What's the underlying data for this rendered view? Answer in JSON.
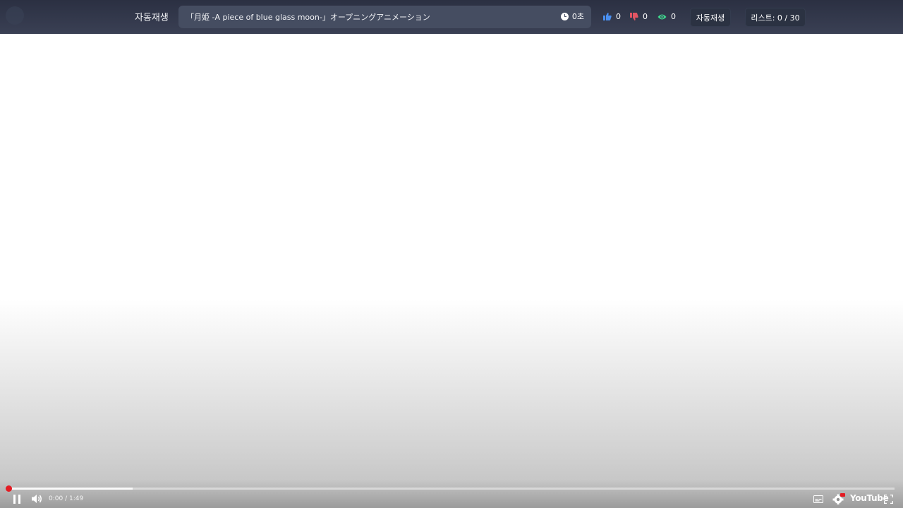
{
  "header": {
    "autoplay_title": "자동재생",
    "video_title": "「月姫 -A piece of blue glass moon-」オープニングアニメーション",
    "timer": "0초",
    "likes": "0",
    "dislikes": "0",
    "views": "0",
    "autoplay_button": "자동재생",
    "list_counter": "리스트: 0 / 30"
  },
  "player": {
    "time": "0:00 / 1:49",
    "progress_played_fraction": 0.0,
    "progress_buffered_fraction": 0.14,
    "brand": "YouTube",
    "icons": [
      "pause-icon",
      "volume-icon",
      "subtitles-icon",
      "settings-hd-icon",
      "fullscreen-icon"
    ],
    "accent_color": "#e41b23"
  },
  "colors": {
    "header_bg": "#2b3042",
    "title_box_bg": "#454d61",
    "like_color": "#4a8ff0",
    "dislike_color": "#e25563",
    "views_color": "#3dd68c"
  }
}
